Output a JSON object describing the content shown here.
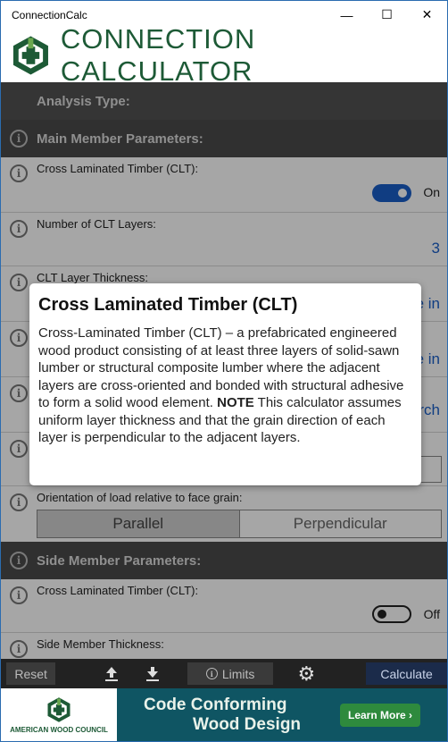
{
  "window": {
    "title": "ConnectionCalc",
    "minimize_glyph": "—",
    "maximize_glyph": "☐",
    "close_glyph": "✕"
  },
  "header": {
    "app_title": "CONNECTION CALCULATOR",
    "logo_icon": "awc-logo-icon",
    "brand_color": "#1d5a36"
  },
  "analysis": {
    "label": "Analysis Type:"
  },
  "main_member": {
    "section_label": "Main Member Parameters:",
    "clt_label": "Cross Laminated Timber (CLT):",
    "clt_toggle_state": "On",
    "layers_label": "Number of CLT Layers:",
    "layers_value": "3",
    "thickness_label": "CLT Layer Thickness:",
    "thickness_value_partial": "e in",
    "row4_value_partial": "e in",
    "row5_value_partial": "rch",
    "orientation_label": "Orientation of load relative to face grain:",
    "orientation_options": [
      "Parallel",
      "Perpendicular"
    ],
    "orientation_selected": "Parallel"
  },
  "side_member": {
    "section_label": "Side Member Parameters:",
    "clt_label": "Cross Laminated Timber (CLT):",
    "clt_toggle_state": "Off",
    "thickness_label": "Side Member Thickness:"
  },
  "dialog": {
    "title": "Cross Laminated Timber (CLT)",
    "body_text": "Cross-Laminated Timber (CLT) – a prefabricated engineered wood product consisting of at least three layers of solid-sawn lumber or structural composite lumber where the adjacent layers are cross-oriented and bonded with structural adhesive to form a solid wood element. ",
    "note_label": "NOTE",
    "note_text": " This calculator assumes uniform layer thickness and that the grain direction of each layer is perpendicular to the adjacent layers."
  },
  "toolbar": {
    "reset_label": "Reset",
    "upload_icon": "upload-icon",
    "download_icon": "download-icon",
    "limits_label": "Limits",
    "settings_icon": "gear-icon",
    "calculate_label": "Calculate"
  },
  "banner": {
    "org_name": "AMERICAN WOOD COUNCIL",
    "line1": "Code Conforming",
    "line2": "Wood Design",
    "cta": "Learn More ›"
  },
  "colors": {
    "accent_blue": "#1a5fc8",
    "section_bg": "#4a4a4a",
    "banner_bg": "#0f5563",
    "cta_green": "#2e8a3d"
  }
}
